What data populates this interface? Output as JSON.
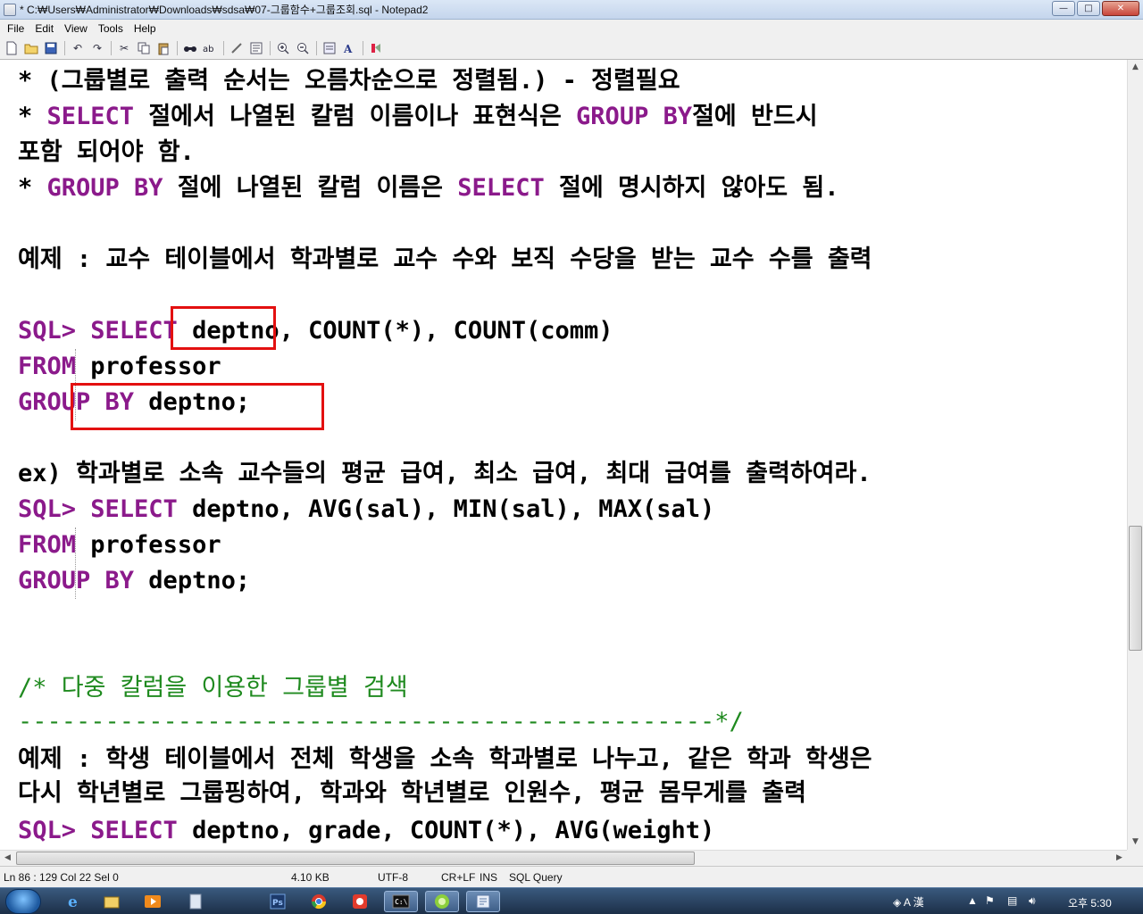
{
  "window": {
    "title": "* C:₩Users₩Administrator₩Downloads₩sdsa₩07-그룹함수+그룹조회.sql - Notepad2",
    "minimize": "—",
    "maximize": "□",
    "close": "✕"
  },
  "menu": [
    "File",
    "Edit",
    "View",
    "Tools",
    "Help"
  ],
  "toolbar": [
    "new-file-icon",
    "open-folder-icon",
    "save-icon",
    "sep",
    "undo-icon",
    "redo-icon",
    "sep",
    "cut-icon",
    "copy-icon",
    "paste-icon",
    "sep",
    "find-icon",
    "replace-icon",
    "sep",
    "word-wrap-icon",
    "select-all-icon",
    "sep",
    "zoom-in-icon",
    "zoom-out-icon",
    "sep",
    "scheme-icon",
    "font-icon",
    "sep",
    "settings-icon"
  ],
  "editor": {
    "lines": {
      "l1": "  * (그룹별로 출력 순서는 오름차순으로 정렬됨.) - 정렬필요",
      "l2a": "  * ",
      "l2b": "SELECT",
      "l2c": " 절에서 나열된 칼럼 이름이나 표현식은 ",
      "l2d": "GROUP BY",
      "l2e": "절에 반드시",
      "l3": "    포함 되어야 함.",
      "l4a": "  * ",
      "l4b": "GROUP BY",
      "l4c": " 절에 나열된 칼럼 이름은 ",
      "l4d": "SELECT",
      "l4e": " 절에 명시하지 않아도 됨.",
      "l5": "예제 : 교수 테이블에서 학과별로 교수 수와 보직 수당을 받는 교수 수를 출력",
      "l6a": "SQL> ",
      "l6b": "SELECT",
      "l6c": " deptno, COUNT(*), COUNT(comm)",
      "l7a": "     ",
      "l7b": "FROM",
      "l7c": " professor",
      "l8a": "     ",
      "l8b": "GROUP BY",
      "l8c": " deptno;",
      "l9": "ex) 학과별로 소속 교수들의 평균 급여, 최소 급여, 최대 급여를 출력하여라.",
      "l10a": "SQL> ",
      "l10b": "SELECT",
      "l10c": " deptno, AVG(sal), MIN(sal), MAX(sal)",
      "l11a": "     ",
      "l11b": "FROM",
      "l11c": " professor",
      "l12a": "     ",
      "l12b": "GROUP BY",
      "l12c": " deptno;",
      "l13": "/* 다중 칼럼을 이용한 그룹별 검색",
      "l14": " ------------------------------------------------*/",
      "l15": "예제 : 학생 테이블에서 전체 학생을 소속 학과별로 나누고, 같은 학과 학생은",
      "l16": "      다시 학년별로 그룹핑하여, 학과와 학년별로 인원수, 평균 몸무게를 출력",
      "l17a": "SQL> ",
      "l17b": "SELECT",
      "l17c": " deptno, grade, COUNT(*), AVG(weight)"
    }
  },
  "status": {
    "position": "Ln 86 : 129   Col 22   Sel 0",
    "size": "4.10 KB",
    "encoding": "UTF-8",
    "eol": "CR+LF",
    "mode": "INS",
    "scheme": "SQL Query"
  },
  "taskbar": {
    "items": [
      "ie-icon",
      "explorer-icon",
      "media-player-icon",
      "notepad-taskbar-icon",
      "photoshop-icon",
      "chrome-icon",
      "app-red-icon",
      "cmd-icon",
      "green-app-icon",
      "notepad2-taskbar-icon"
    ],
    "ime": "A 漢",
    "clock": "오후 5:30"
  },
  "colors": {
    "keyword": "#8b1a8b",
    "comment": "#1f8a1f",
    "highlight_box": "#e31010"
  }
}
